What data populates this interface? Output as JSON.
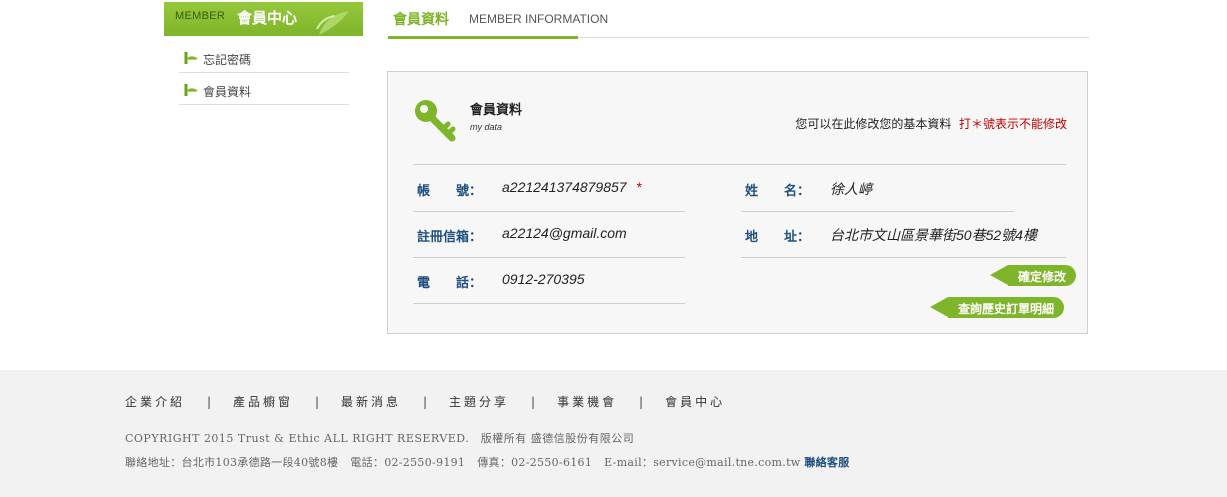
{
  "sidebar": {
    "header_en": "MEMBER",
    "header_zh": "會員中心",
    "items": [
      {
        "label": "忘記密碼"
      },
      {
        "label": "會員資料"
      }
    ]
  },
  "page_title": {
    "zh": "會員資料",
    "en": "MEMBER INFORMATION"
  },
  "box": {
    "title": "會員資料",
    "subtitle": "my data",
    "note": "您可以在此修改您的基本資料",
    "note_red": "打＊號表示不能修改",
    "fields": {
      "account": {
        "label": "帳　　號：",
        "value": "a221241374879857",
        "required_mark": "*"
      },
      "email": {
        "label": "註冊信箱：",
        "value": "a22124@gmail.com"
      },
      "phone": {
        "label": "電　　話：",
        "value": "0912-270395"
      },
      "name": {
        "label": "姓　　名：",
        "value": "徐人嵉"
      },
      "address": {
        "label": "地　　址：",
        "value": "台北市文山區景華街50巷52號4樓"
      }
    },
    "confirm_button": "確定修改",
    "history_button": "查詢歷史訂單明細"
  },
  "footer": {
    "nav": [
      "企業介紹",
      "產品櫥窗",
      "最新消息",
      "主題分享",
      "事業機會",
      "會員中心"
    ],
    "separator": "|",
    "copyright": "COPYRIGHT 2015 Trust & Ethic ALL RIGHT RESERVED.　版權所有 盛德信股份有限公司",
    "address": "聯絡地址：台北市103承德路一段40號8樓",
    "phone": "電話：02-2550-9191",
    "fax": "傳真：02-2550-6161",
    "email": "E-mail：service@mail.tne.com.tw",
    "customer_service": "聯絡客服"
  },
  "colors": {
    "brand_green": "#7fb52a",
    "label_blue": "#1f4f7f",
    "required_red": "#c00000"
  }
}
